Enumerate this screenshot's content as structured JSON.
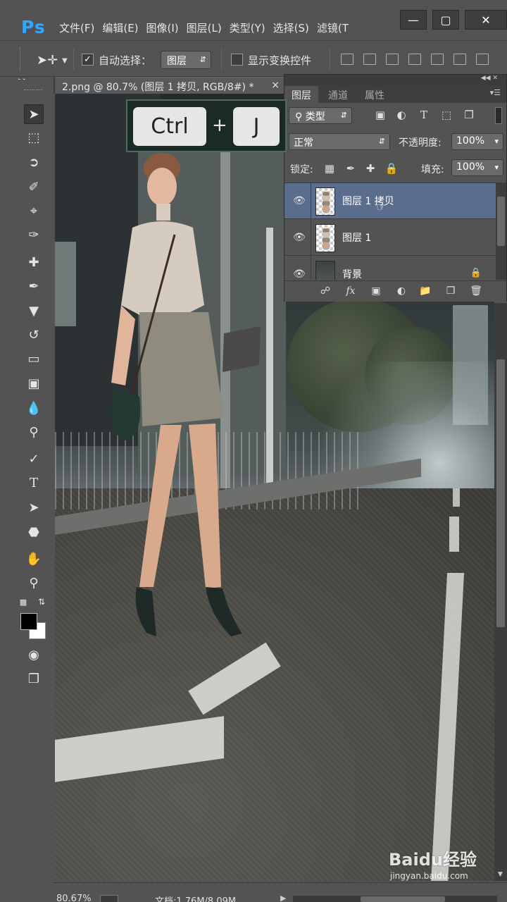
{
  "app": {
    "logo": "Ps",
    "menu": [
      "文件(F)",
      "编辑(E)",
      "图像(I)",
      "图层(L)",
      "类型(Y)",
      "选择(S)",
      "滤镜(T"
    ],
    "window_controls": [
      "minimize",
      "maximize",
      "close"
    ]
  },
  "options_bar": {
    "auto_select_label": "自动选择：",
    "auto_select_checked": true,
    "auto_select_target": "图层",
    "show_transform_label": "显示变换控件",
    "show_transform_checked": false
  },
  "document": {
    "tab_title": "2.png @ 80.7% (图层 1  拷贝, RGB/8#) *",
    "close_symbol": "×"
  },
  "shortcut_overlay": {
    "key1": "Ctrl",
    "plus": "+",
    "key2": "J"
  },
  "layers_panel": {
    "tabs": [
      "图层",
      "通道",
      "属性"
    ],
    "active_tab": "图层",
    "filter_type": "类型",
    "blend_mode": "正常",
    "opacity_label": "不透明度:",
    "opacity_value": "100%",
    "lock_label": "锁定:",
    "fill_label": "填充:",
    "fill_value": "100%",
    "layers": [
      {
        "name": "图层 1 拷贝",
        "visible": true,
        "selected": true
      },
      {
        "name": "图层 1",
        "visible": true,
        "selected": false
      },
      {
        "name": "背景",
        "visible": true,
        "selected": false,
        "locked": true
      }
    ]
  },
  "status_bar": {
    "zoom": "80.67%",
    "doc_info": "文档:1.76M/8.09M"
  },
  "watermark": {
    "brand": "Baidu经验",
    "url": "jingyan.baidu.com"
  },
  "colors": {
    "ui_bg": "#535353",
    "ps_logo": "#31a8ff",
    "selected_layer": "#5b6d8d",
    "overlay_bg": "#1c2a26"
  }
}
